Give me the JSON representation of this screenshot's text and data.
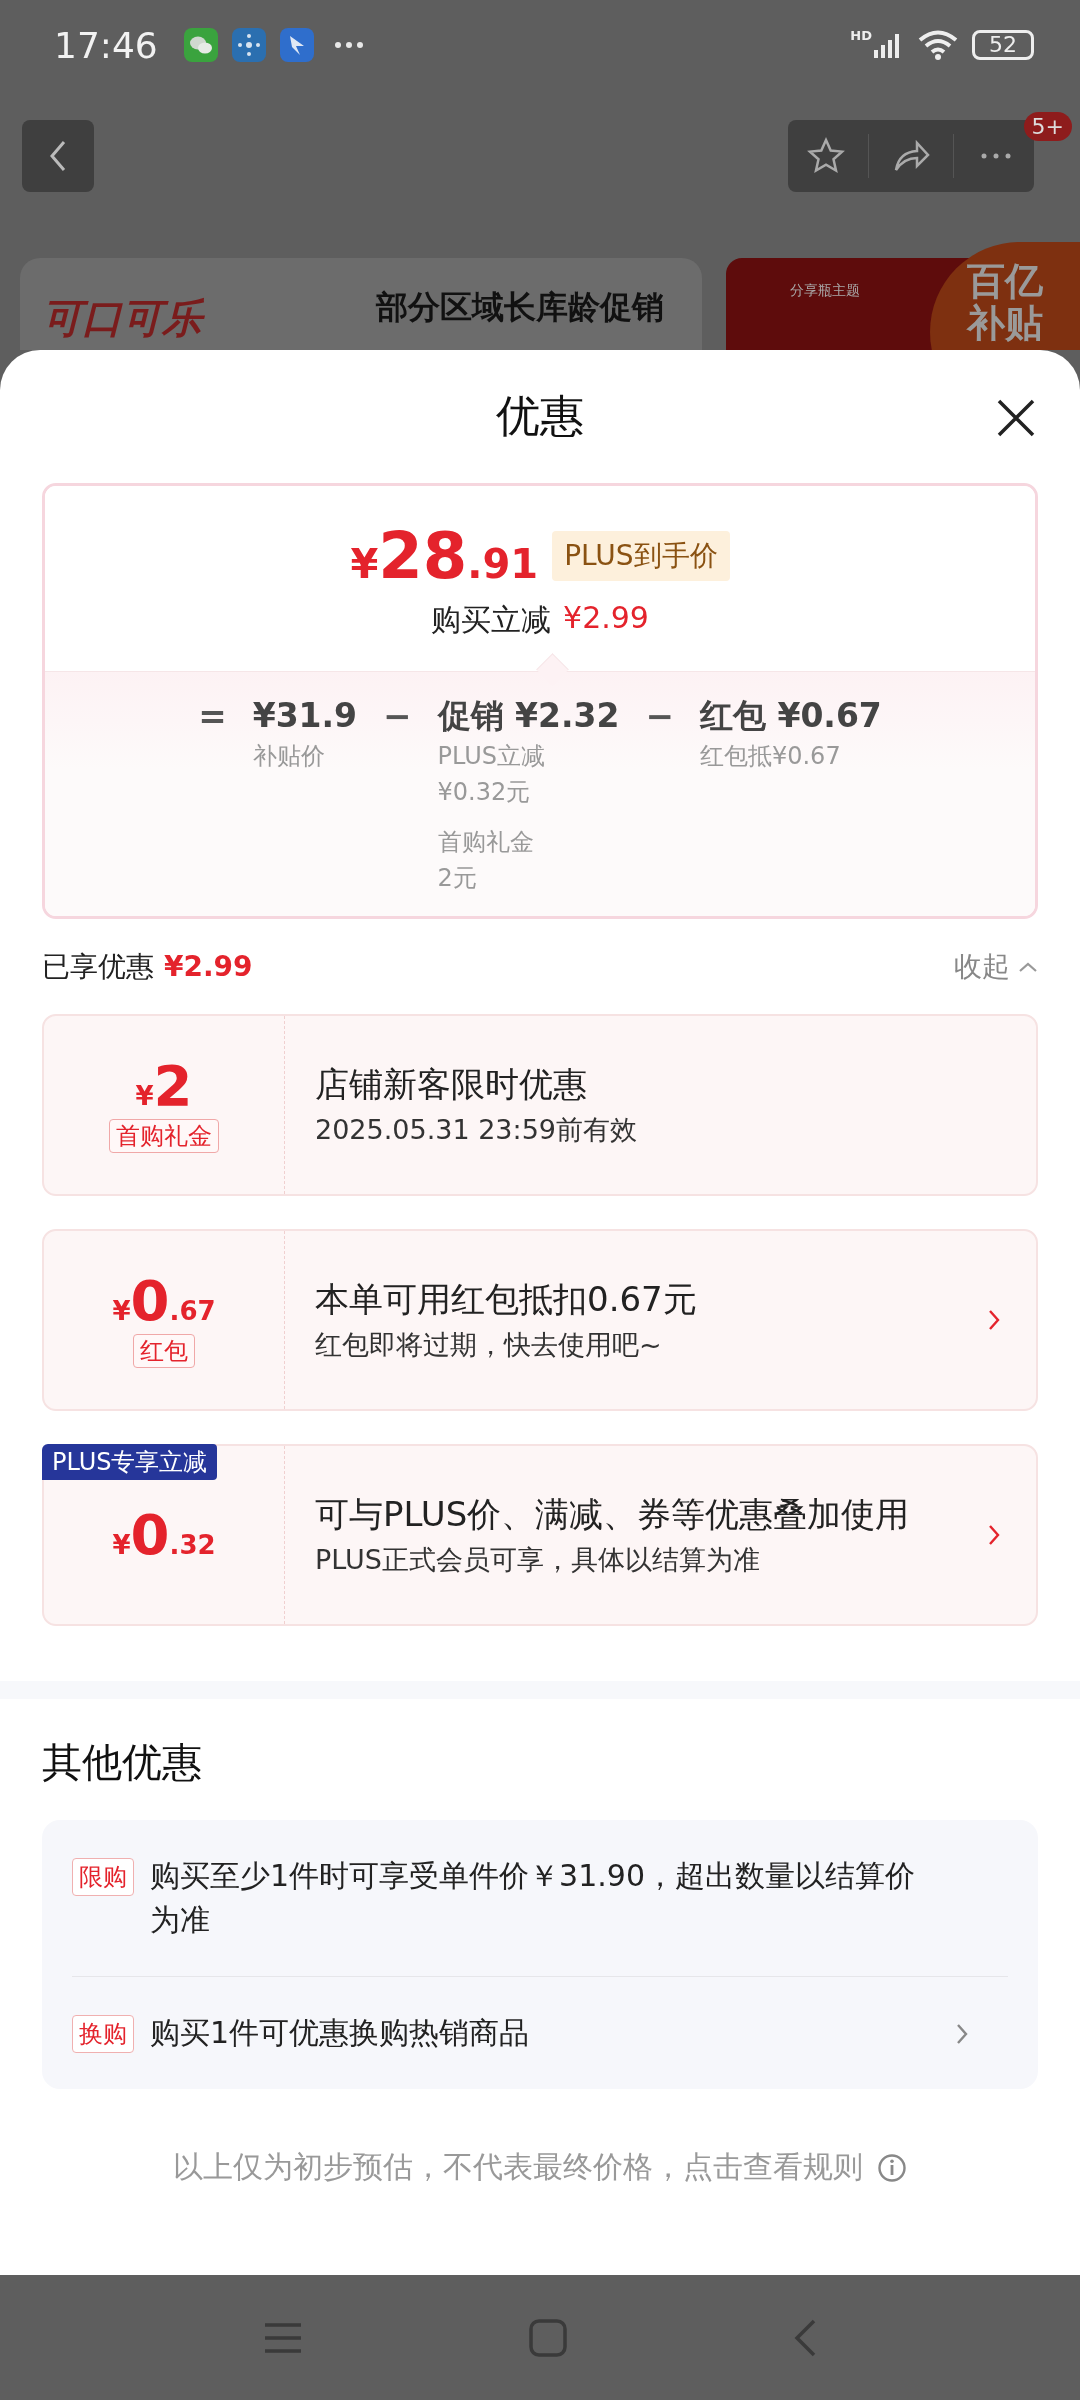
{
  "status_bar": {
    "time": "17:46",
    "network_label": "HD",
    "battery": "52"
  },
  "nav": {
    "badge": "5+"
  },
  "banner": {
    "logo_text": "可口可乐",
    "headline": "部分区域长库龄促销",
    "side_caption": "分享瓶主题",
    "badge_lines": [
      "百亿",
      "补贴"
    ]
  },
  "sheet": {
    "title": "优惠"
  },
  "price_card": {
    "currency": "¥",
    "price_int": "28",
    "price_dec": ".91",
    "tag": "PLUS到手价",
    "saving_label": "购买立减",
    "saving_value": "¥2.99",
    "breakdown": [
      {
        "op": "=",
        "value": "¥31.9",
        "details": [
          {
            "name": "补贴价"
          }
        ]
      },
      {
        "op": "−",
        "value": "促销 ¥2.32",
        "details": [
          {
            "name": "PLUS立减",
            "amount": "¥0.32元"
          },
          {
            "name": "首购礼金",
            "amount": "2元"
          }
        ]
      },
      {
        "op": "−",
        "value": "红包 ¥0.67",
        "details": [
          {
            "name": "红包抵¥0.67"
          }
        ]
      }
    ]
  },
  "summary": {
    "label": "已享优惠",
    "value": "¥2.99",
    "toggle": "收起",
    "expanded": true
  },
  "coupons": [
    {
      "currency": "¥",
      "amount_int": "2",
      "tag": "首购礼金",
      "title": "店铺新客限时优惠",
      "subtitle": "2025.05.31 23:59前有效",
      "has_arrow": false
    },
    {
      "currency": "¥",
      "amount_int": "0",
      "amount_dec": ".67",
      "tag": "红包",
      "title": "本单可用红包抵扣0.67元",
      "subtitle": "红包即将过期，快去使用吧~",
      "has_arrow": true
    },
    {
      "currency": "¥",
      "amount_int": "0",
      "amount_dec": ".32",
      "corner_label": "PLUS专享立减",
      "title": "可与PLUS价、满减、券等优惠叠加使用",
      "subtitle": "PLUS正式会员可享，具体以结算为准",
      "has_arrow": true
    }
  ],
  "other": {
    "title": "其他优惠",
    "items": [
      {
        "tag": "限购",
        "text": "购买至少1件时可享受单件价￥31.90，超出数量以结算价为准",
        "has_arrow": false
      },
      {
        "tag": "换购",
        "text": "购买1件可优惠换购热销商品",
        "has_arrow": true
      }
    ]
  },
  "footer": {
    "note": "以上仅为初步预估，不代表最终价格，点击查看规则"
  }
}
